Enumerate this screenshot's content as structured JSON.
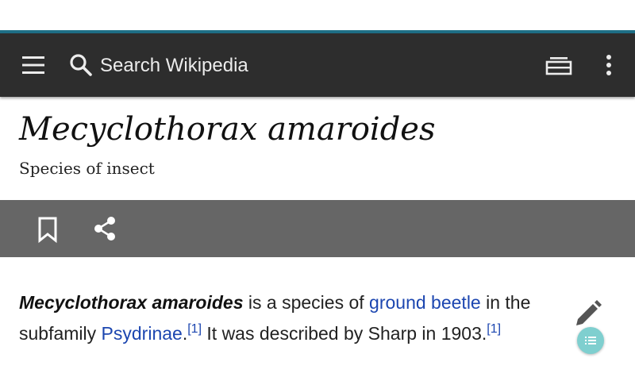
{
  "toolbar": {
    "search_placeholder": "Search Wikipedia",
    "icons": {
      "menu": "menu-icon",
      "search": "search-icon",
      "tabs": "tabs-icon",
      "overflow": "more-vert-icon"
    }
  },
  "article": {
    "title": "Mecyclothorax amaroides",
    "description": "Species of insect",
    "actions": {
      "bookmark": "bookmark-icon",
      "share": "share-icon"
    },
    "lead": {
      "bold_title": "Mecyclothorax amaroides",
      "t1": " is a species of ",
      "link1": "ground beetle",
      "t2": " in the subfamily ",
      "link2": "Psydrinae",
      "t3": ".",
      "ref1": "[1]",
      "t4": " It was described by Sharp in 1903.",
      "ref2": "[1]"
    }
  },
  "floating": {
    "edit": "pencil-icon",
    "toc": "list-icon"
  },
  "colors": {
    "toolbar_bg": "#2d2d2d",
    "accent_line": "#1e6f86",
    "action_bar_bg": "#666666",
    "link": "#1c46b0",
    "fab": "#7fcfcf"
  }
}
